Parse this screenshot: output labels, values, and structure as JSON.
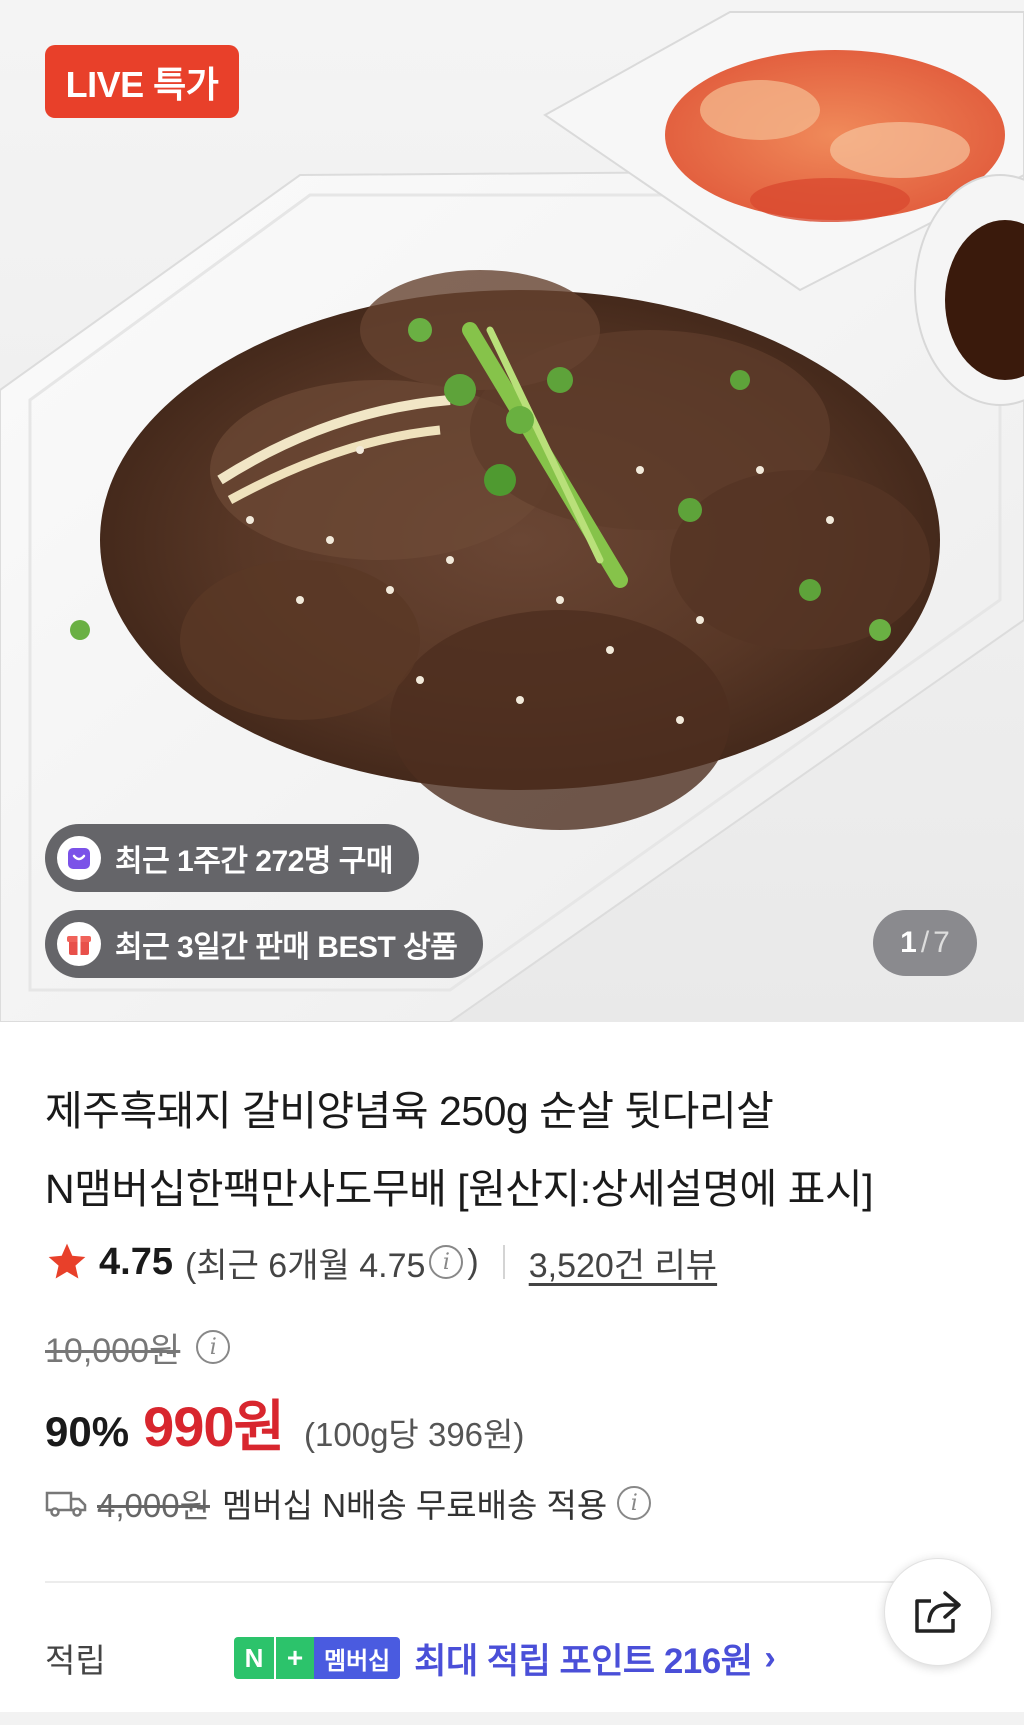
{
  "hero": {
    "badge": "LIVE 특가",
    "chips": [
      {
        "icon": "shopping-bag-icon",
        "text": "최근 1주간 272명 구매"
      },
      {
        "icon": "gift-box-icon",
        "text": "최근 3일간 판매 BEST 상품"
      }
    ],
    "pager": {
      "current": "1",
      "separator": "/",
      "total": "7"
    }
  },
  "product": {
    "title_line1": "제주흑돼지 갈비양념육 250g 순살 뒷다리살",
    "title_line2": "N맴버십한팩만사도무배 [원산지:상세설명에 표시]"
  },
  "rating": {
    "score": "4.75",
    "recent_prefix": "(최근 6개월 4.75",
    "recent_suffix": ")",
    "reviews": "3,520건 리뷰"
  },
  "price": {
    "original": "10,000원",
    "discount": "90%",
    "sale": "990원",
    "unit_price": "(100g당 396원)"
  },
  "shipping": {
    "original_fee": "4,000원",
    "text": "멤버십 N배송 무료배송 적용"
  },
  "points": {
    "label": "적립",
    "badge_n": "N",
    "badge_plus": "+",
    "badge_membership": "멤버십",
    "text": "최대 적립 포인트 216원",
    "chevron": "›"
  },
  "colors": {
    "live_badge": "#e8402a",
    "sale_price": "#d8262e",
    "star": "#e8402a",
    "points_text": "#4a4fd8",
    "npay_green": "#2cc36b",
    "membership_blue": "#4a5be0"
  }
}
